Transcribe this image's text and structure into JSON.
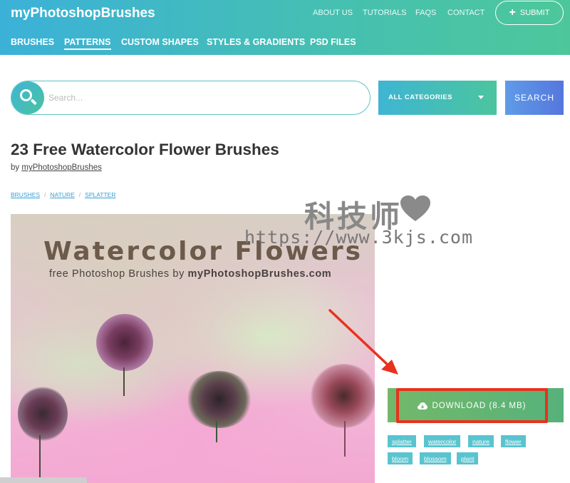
{
  "header": {
    "logo": "myPhotoshopBrushes",
    "top_links": [
      "ABOUT US",
      "TUTORIALS",
      "FAQS",
      "CONTACT"
    ],
    "submit_label": "SUBMIT",
    "main_nav": [
      "BRUSHES",
      "PATTERNS",
      "CUSTOM SHAPES",
      "STYLES & GRADIENTS",
      "PSD FILES"
    ],
    "active_nav": "PATTERNS"
  },
  "search": {
    "placeholder": "Search...",
    "category_label": "ALL CATEGORIES",
    "button_label": "SEARCH"
  },
  "article": {
    "title": "23 Free Watercolor Flower Brushes",
    "by": "by",
    "author": "myPhotoshopBrushes",
    "breadcrumbs": [
      "BRUSHES",
      "NATURE",
      "SPLATTER"
    ],
    "breadcrumb_sep": "/"
  },
  "hero": {
    "title": "Watercolor Flowers",
    "subtitle_prefix": "free Photoshop Brushes by ",
    "subtitle_brand": "myPhotoshopBrushes.com"
  },
  "watermark": {
    "text": "科技师",
    "url": "https://www.3kjs.com"
  },
  "download": {
    "label": "DOWNLOAD (8.4 MB)"
  },
  "tags": [
    "splatter",
    "watercolor",
    "nature",
    "flower",
    "bloom",
    "blossom",
    "plant"
  ],
  "colors": {
    "header_start": "#3bb1d8",
    "header_end": "#4dc79a",
    "download_green": "#6bb56f",
    "highlight_red": "#e8321e",
    "tag_bg": "#59c4cf",
    "search_button": "#5a8ae3"
  }
}
